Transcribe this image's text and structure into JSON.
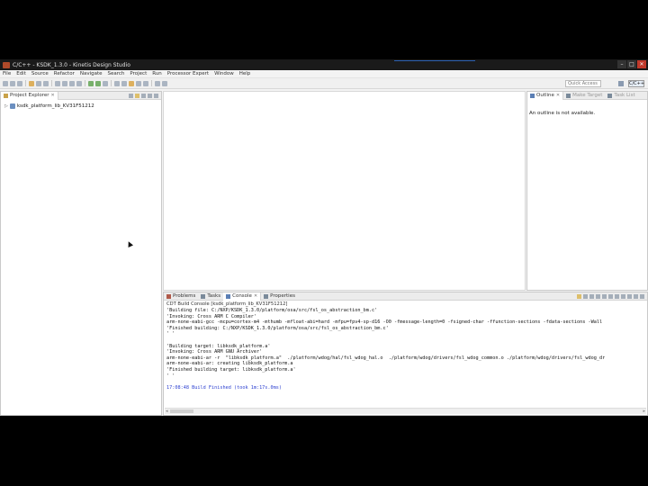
{
  "window": {
    "title": "C/C++ - KSDK_1.3.0 - Kinetis Design Studio"
  },
  "menu": [
    "File",
    "Edit",
    "Source",
    "Refactor",
    "Navigate",
    "Search",
    "Project",
    "Run",
    "Processor Expert",
    "Window",
    "Help"
  ],
  "toolbar": {
    "quick_access_placeholder": "Quick Access",
    "perspective_label": "C/C++"
  },
  "project_explorer": {
    "tab_label": "Project Explorer",
    "close_glyph": "✕",
    "project_name": "ksdk_platform_lib_KV31F51212"
  },
  "outline": {
    "tabs": [
      {
        "label": "Outline",
        "active": true
      },
      {
        "label": "Make Target",
        "active": false
      },
      {
        "label": "Task List",
        "active": false
      }
    ],
    "message": "An outline is not available."
  },
  "console": {
    "tabs": [
      {
        "label": "Problems",
        "active": false
      },
      {
        "label": "Tasks",
        "active": false
      },
      {
        "label": "Console",
        "active": true
      },
      {
        "label": "Properties",
        "active": false
      }
    ],
    "header": "CDT Build Console [ksdk_platform_lib_KV31F51212]",
    "lines": [
      {
        "text": "'Building file: C:/NXP/KSDK_1.3.0/platform/osa/src/fsl_os_abstraction_bm.c'",
        "blue": false
      },
      {
        "text": "'Invoking: Cross ARM C Compiler'",
        "blue": false
      },
      {
        "text": "arm-none-eabi-gcc -mcpu=cortex-m4 -mthumb -mfloat-abi=hard -mfpu=fpv4-sp-d16 -O0 -fmessage-length=0 -fsigned-char -ffunction-sections -fdata-sections -Wall",
        "blue": false
      },
      {
        "text": "'Finished building: C:/NXP/KSDK_1.3.0/platform/osa/src/fsl_os_abstraction_bm.c'",
        "blue": false
      },
      {
        "text": "' '",
        "blue": false
      },
      {
        "text": "",
        "blue": false
      },
      {
        "text": "'Building target: libksdk_platform.a'",
        "blue": false
      },
      {
        "text": "'Invoking: Cross ARM GNU Archiver'",
        "blue": false
      },
      {
        "text": "arm-none-eabi-ar -r  \"libksdk_platform.a\"  ./platform/wdog/hal/fsl_wdog_hal.o  ./platform/wdog/drivers/fsl_wdog_common.o ./platform/wdog/drivers/fsl_wdog_dr",
        "blue": false
      },
      {
        "text": "arm-none-eabi-ar: creating libksdk_platform.a",
        "blue": false
      },
      {
        "text": "'Finished building target: libksdk_platform.a'",
        "blue": false
      },
      {
        "text": "' '",
        "blue": false
      },
      {
        "text": "",
        "blue": false
      },
      {
        "text": "17:08:48 Build Finished (took 1m:17s.0ms)",
        "blue": true
      }
    ]
  },
  "colors": {
    "console_finished": "#2b3fd0",
    "close_button": "#c0392b"
  }
}
